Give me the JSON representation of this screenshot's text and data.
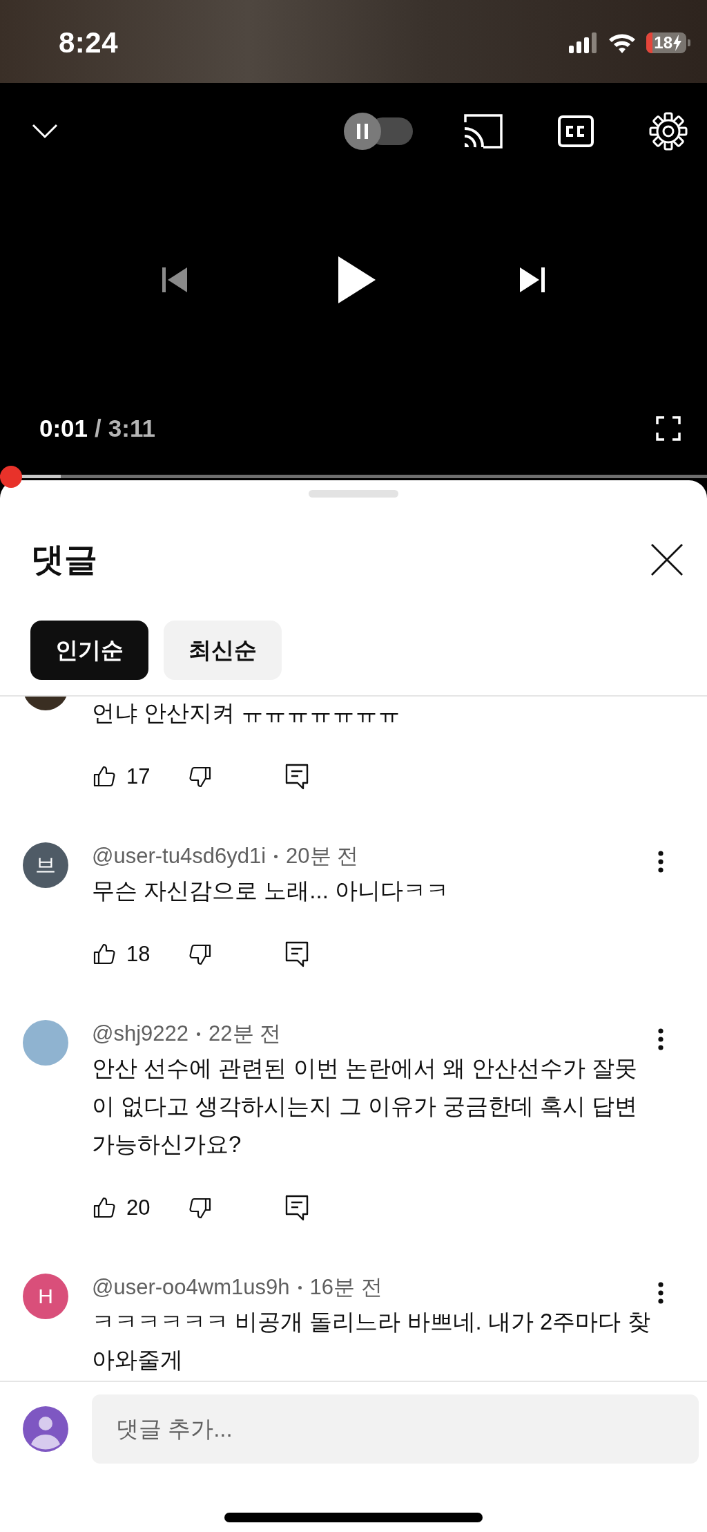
{
  "status_bar": {
    "time": "8:24",
    "battery": {
      "label": "18",
      "charging": true
    }
  },
  "player": {
    "autoplay": {
      "on": false
    },
    "previous": {
      "disabled": true
    },
    "next": {
      "disabled": false
    },
    "elapsed": "0:01",
    "separator": "/",
    "duration": "3:11",
    "progress": {
      "level": 0.016
    }
  },
  "comments_panel": {
    "title": "댓글",
    "sort_tabs": [
      {
        "label": "인기순",
        "selected": true
      },
      {
        "label": "최신순",
        "selected": false
      }
    ],
    "comments": [
      {
        "avatar": {
          "kind": "photo",
          "color": "#3a2e22"
        },
        "body": "언냐 안산지켜 ㅠㅠㅠㅠㅠㅠㅠ",
        "likes": "17"
      },
      {
        "avatar": {
          "kind": "letter",
          "letter": "브",
          "color": "#4f5b66"
        },
        "author": "@user-tu4sd6yd1i",
        "time": "20분 전",
        "body": "무슨 자신감으로 노래... 아니다ㅋㅋ",
        "likes": "18"
      },
      {
        "avatar": {
          "kind": "photo",
          "color": "#8fb3d0"
        },
        "author": "@shj9222",
        "time": "22분 전",
        "body": "안산 선수에 관련된 이번 논란에서 왜 안산선수가 잘못이 없다고 생각하시는지 그 이유가 궁금한데 혹시 답변 가능하신가요?",
        "likes": "20"
      },
      {
        "avatar": {
          "kind": "letter",
          "letter": "H",
          "color": "#d94f7a"
        },
        "author": "@user-oo4wm1us9h",
        "time": "16분 전",
        "body": "ㅋㅋㅋㅋㅋㅋ 비공개 돌리느라 바쁘네. 내가 2주마다 찾아와줄게"
      }
    ],
    "input": {
      "placeholder": "댓글 추가..."
    }
  }
}
